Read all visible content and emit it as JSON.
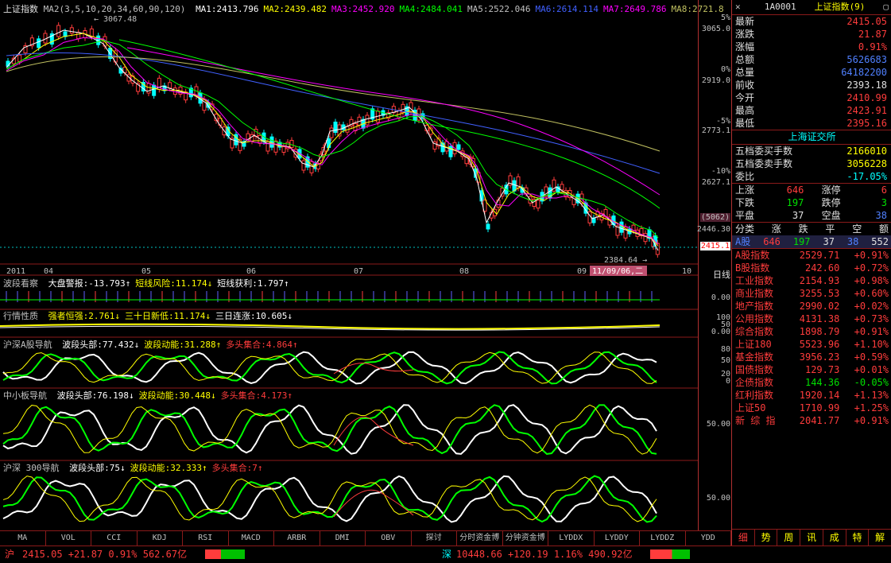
{
  "colors": {
    "up": "#ff3c3c",
    "down": "#00ffff",
    "ma1": "#ffffff",
    "ma2": "#ffff00",
    "ma3": "#ff00ff",
    "ma4": "#00ff00",
    "ma5": "#4060ff",
    "ma6": "#a0a0a0",
    "ma7": "#ff00ff",
    "ma8": "#c0c060"
  },
  "main": {
    "title": "上证指数",
    "ma_params": "MA2(3,5,10,20,34,60,90,120)",
    "ma_values": [
      {
        "label": "MA1:2413.796",
        "color": "#ffffff"
      },
      {
        "label": "MA2:2439.482",
        "color": "#ffff00"
      },
      {
        "label": "MA3:2452.920",
        "color": "#ff00ff"
      },
      {
        "label": "MA4:2484.041",
        "color": "#00ff00"
      },
      {
        "label": "MA5:2522.046",
        "color": "#c0c0c0"
      },
      {
        "label": "MA6:2614.114",
        "color": "#4060ff"
      },
      {
        "label": "MA7:2649.786",
        "color": "#ff00ff"
      },
      {
        "label": "MA8:2721.8",
        "color": "#c0c060"
      }
    ],
    "high_label": "3067.48",
    "low_label": "2384.64",
    "axis_labels": [
      "3065.0",
      "2919.0",
      "2773.1",
      "2627.1"
    ],
    "pct_labels": [
      "5%",
      "0%",
      "-5%",
      "-10%"
    ],
    "box_label": "(5062)",
    "mid_label": "2446.30",
    "current_label": "2415.1",
    "x_labels": [
      "2011",
      "04",
      "05",
      "06",
      "07",
      "08",
      "09",
      "11/09/06,二",
      "10"
    ],
    "x_right": "日线"
  },
  "pane1": {
    "name": "波段看察",
    "items": [
      {
        "t": "大盘警报:-13.793↑",
        "c": "#ffffff"
      },
      {
        "t": "短线风险:11.174↓",
        "c": "#ffff00"
      },
      {
        "t": "短线获利:1.797↑",
        "c": "#ffffff"
      }
    ],
    "axis": "0.00"
  },
  "pane2": {
    "name": "行情性质",
    "items": [
      {
        "t": "强者恒强:2.761↓",
        "c": "#ffff00"
      },
      {
        "t": "三十日新低:11.174↓",
        "c": "#ffff00"
      },
      {
        "t": "三日连涨:10.605↓",
        "c": "#ffffff"
      }
    ],
    "axis": [
      "100",
      "50",
      "0.00"
    ]
  },
  "pane3": {
    "name": "沪深A股导航",
    "items": [
      {
        "t": "波段头部:77.432↓",
        "c": "#ffffff"
      },
      {
        "t": "波段动能:31.288↑",
        "c": "#ffff00"
      },
      {
        "t": "多头集合:4.864↑",
        "c": "#ff3c3c"
      }
    ],
    "axis": [
      "80",
      "50",
      "20",
      "0"
    ]
  },
  "pane4": {
    "name": "中小板导航",
    "items": [
      {
        "t": "波段头部:76.198↓",
        "c": "#ffffff"
      },
      {
        "t": "波段动能:30.448↓",
        "c": "#ffff00"
      },
      {
        "t": "多头集合:4.173↑",
        "c": "#ff3c3c"
      }
    ],
    "axis": "50.00"
  },
  "pane5": {
    "name": "沪深 300导航",
    "items": [
      {
        "t": "波段头部:75↓",
        "c": "#ffffff"
      },
      {
        "t": "波段动能:32.333↑",
        "c": "#ffff00"
      },
      {
        "t": "多头集合:7↑",
        "c": "#ff3c3c"
      }
    ],
    "axis": "50.00"
  },
  "tabs": [
    "MA",
    "VOL",
    "CCI",
    "KDJ",
    "RSI",
    "MACD",
    "ARBR",
    "DMI",
    "OBV",
    "探讨",
    "分时资金博",
    "分钟资金博",
    "LYDDX",
    "LYDDY",
    "LYDDZ",
    "YDD"
  ],
  "info": {
    "code": "1A0001",
    "name": "上证指数",
    "num": "(9)",
    "rows": [
      {
        "k": "最新",
        "v": "2415.05",
        "c": "#ff3c3c"
      },
      {
        "k": "涨跌",
        "v": "21.87",
        "c": "#ff3c3c"
      },
      {
        "k": "涨幅",
        "v": "0.91%",
        "c": "#ff3c3c"
      },
      {
        "k": "总额",
        "v": "5626683",
        "c": "#5080ff"
      },
      {
        "k": "总量",
        "v": "64182200",
        "c": "#5080ff"
      },
      {
        "k": "前收",
        "v": "2393.18",
        "c": "#e0e0e0"
      },
      {
        "k": "今开",
        "v": "2410.99",
        "c": "#ff3c3c"
      },
      {
        "k": "最高",
        "v": "2423.91",
        "c": "#ff3c3c"
      },
      {
        "k": "最低",
        "v": "2395.16",
        "c": "#ff3c3c"
      }
    ],
    "exch": "上海证交所",
    "rows2": [
      {
        "k": "五档委买手数",
        "v": "2166010",
        "c": "#ffff00"
      },
      {
        "k": "五档委卖手数",
        "v": "3056228",
        "c": "#ffff00"
      },
      {
        "k": "委比",
        "v": "-17.05%",
        "c": "#00ffff"
      }
    ],
    "stats": [
      {
        "a": "上涨",
        "b": "646",
        "c": "涨停",
        "d": "6",
        "bc": "#ff3c3c",
        "dc": "#ff3c3c"
      },
      {
        "a": "下跌",
        "b": "197",
        "c": "跌停",
        "d": "3",
        "bc": "#00e000",
        "dc": "#00e000"
      },
      {
        "a": "平盘",
        "b": "37",
        "c": "空盘",
        "d": "38",
        "bc": "#e0e0e0",
        "dc": "#5080ff"
      }
    ],
    "cls_head": [
      "分类",
      "涨",
      "跌",
      "平",
      "空",
      "额"
    ],
    "cls_row": [
      "A股",
      "646",
      "197",
      "37",
      "38",
      "552"
    ],
    "indices": [
      [
        "A股指数",
        "2529.71",
        "+0.91%"
      ],
      [
        "B股指数",
        "242.60",
        "+0.72%"
      ],
      [
        "工业指数",
        "2154.93",
        "+0.98%"
      ],
      [
        "商业指数",
        "3255.53",
        "+0.60%"
      ],
      [
        "地产指数",
        "2990.02",
        "+0.02%"
      ],
      [
        "公用指数",
        "4131.38",
        "+0.73%"
      ],
      [
        "综合指数",
        "1898.79",
        "+0.91%"
      ],
      [
        "上证180",
        "5523.96",
        "+1.10%"
      ],
      [
        "基金指数",
        "3956.23",
        "+0.59%"
      ],
      [
        "国债指数",
        "129.73",
        "+0.01%"
      ],
      [
        "企债指数",
        "144.36",
        "-0.05%"
      ],
      [
        "红利指数",
        "1920.14",
        "+1.13%"
      ],
      [
        "上证50",
        "1710.99",
        "+1.25%"
      ],
      [
        "新 综 指",
        "2041.77",
        "+0.91%"
      ]
    ],
    "bottom_tabs": [
      "细",
      "势",
      "周",
      "讯",
      "成",
      "特",
      "解"
    ]
  },
  "status": {
    "sh_label": "沪",
    "sh_text": "2415.05  +21.87  0.91%  562.67亿",
    "sz_label": "深",
    "sz_text": "10448.66  +120.19  1.16%  490.92亿"
  }
}
